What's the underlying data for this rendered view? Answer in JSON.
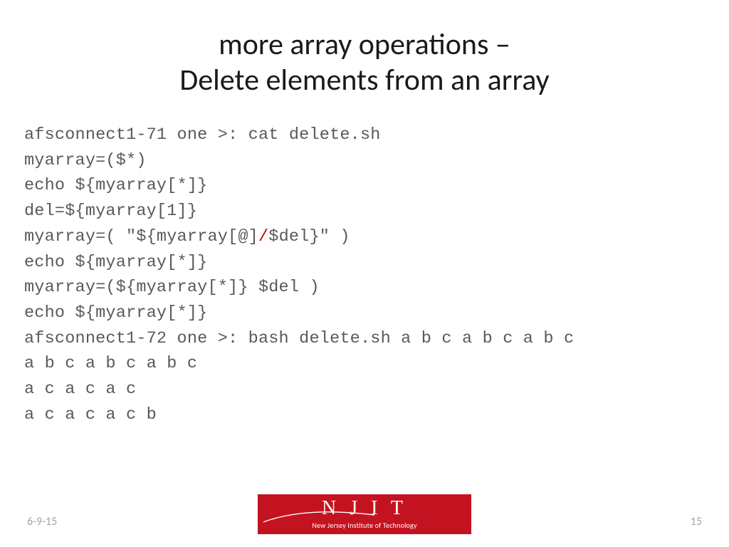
{
  "title_line1": "more array operations –",
  "title_line2": "Delete elements from an array",
  "code": {
    "l1": "afsconnect1-71 one >: cat delete.sh",
    "l2": "myarray=($*)",
    "l3": "echo ${myarray[*]}",
    "l4": "del=${myarray[1]}",
    "l5a": "myarray=( \"${myarray[@]",
    "l5b": "/",
    "l5c": "$del}\" )",
    "l6": "echo ${myarray[*]}",
    "l7": "myarray=(${myarray[*]} $del )",
    "l8": "echo ${myarray[*]}",
    "l9": "afsconnect1-72 one >: bash delete.sh a b c a b c a b c",
    "l10": "a b c a b c a b c",
    "l11": "a c a c a c",
    "l12": "a c a c a c b"
  },
  "footer": {
    "date": "6-9-15",
    "page": "15",
    "logo_main": "N J I T",
    "logo_sub": "New Jersey Institute of Technology"
  }
}
